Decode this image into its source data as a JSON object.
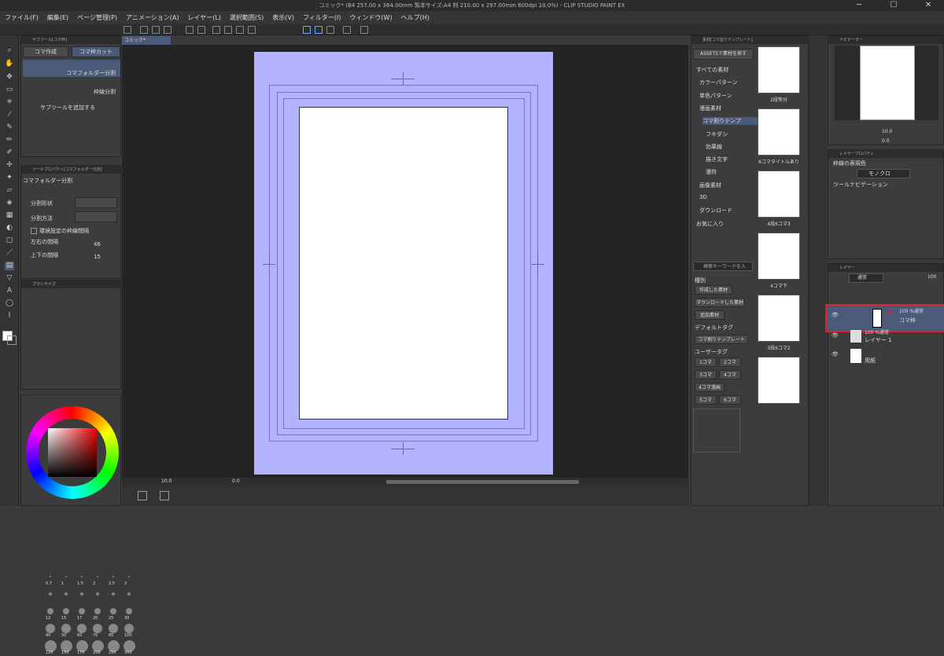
{
  "window": {
    "title": "コミック* (B4 257.00 x 364.00mm 製本サイズ:A4 判 210.00 x 297.00mm 600dpi 10.0%) - CLIP STUDIO PAINT EX",
    "minimize": "─",
    "maximize": "☐",
    "close": "✕"
  },
  "menu": [
    "ファイル(F)",
    "編集(E)",
    "ページ管理(P)",
    "アニメーション(A)",
    "レイヤー(L)",
    "選択範囲(S)",
    "表示(V)",
    "フィルター(I)",
    "ウィンドウ(W)",
    "ヘルプ(H)"
  ],
  "subtool": {
    "header": "サブツール[コマ枠]",
    "tab_create": "コマ作成",
    "tab_cut": "コマ枠カット",
    "item1": "コマフォルダー分割",
    "item2": "枠線分割",
    "add": "サブツールを追加する"
  },
  "toolprop": {
    "header": "ツールプロパティ[コマフォルダー分割]",
    "title": "コマフォルダー分割",
    "shape": "分割形状",
    "method": "分割方法",
    "env": "環境設定の枠線間隔",
    "lr": "左右の間隔",
    "lr_val": "46",
    "ud": "上下の間隔",
    "ud_val": "15"
  },
  "brushsize": {
    "header": "ブラシサイズ",
    "row1": [
      "0.7",
      "1",
      "1.5",
      "2",
      "2.5",
      "3"
    ],
    "row3": [
      "12",
      "15",
      "17",
      "20",
      "25",
      "30"
    ],
    "row4": [
      "40",
      "50",
      "60",
      "70",
      "80",
      "100"
    ],
    "row5": [
      "120",
      "150",
      "170",
      "200",
      "250",
      "300"
    ]
  },
  "canvas": {
    "tab": "コミック*",
    "zoom": "10.0",
    "angle": "0.0"
  },
  "material": {
    "header": "素材[コマ割りテンプレート]",
    "assets": "ASSETSで素材を探す",
    "items": [
      "すべての素材",
      "カラーパターン",
      "単色パターン",
      "漫画素材",
      "コマ割りテンプ",
      "フキダシ",
      "効果線",
      "描き文字",
      "漫符",
      "画像素材",
      "3D",
      "ダウンロード",
      "お気に入り"
    ],
    "search": "検索キーワードを入",
    "kind": "種別",
    "btns": [
      "作成した素材",
      "ダウンロードした素材",
      "追加素材"
    ],
    "default_tag": "デフォルトタグ",
    "tag_template": "コマ割りテンプレート",
    "user_tag": "ユーザータグ",
    "tags": [
      "1コマ",
      "2コマ",
      "3コマ",
      "4コマ",
      "4コマ漫画",
      "5コマ",
      "6コマ"
    ],
    "thumbs": [
      "2段等分",
      "6コマタイトルあり",
      "4段6コマ3",
      "4コマ下",
      "3段6コマ2"
    ]
  },
  "navigator": {
    "header": "ナビゲーター",
    "zoom": "10.0",
    "angle": "0.0"
  },
  "layerprop": {
    "header": "レイヤープロパティ",
    "color_label": "枠線の表現色",
    "color_value": "モノクロ",
    "tool_nav": "ツールナビゲーション"
  },
  "layers": {
    "header": "レイヤー",
    "blend": "通常",
    "opacity": "100",
    "rows": [
      {
        "top": "100 %通常",
        "name": "コマ枠"
      },
      {
        "top": "100 %通常",
        "name": "レイヤー 1"
      },
      {
        "top": "",
        "name": "用紙"
      }
    ]
  },
  "colors": {
    "accent": "#4a5a78",
    "highlight": "#e0202a",
    "page": "#b3b3ff"
  }
}
